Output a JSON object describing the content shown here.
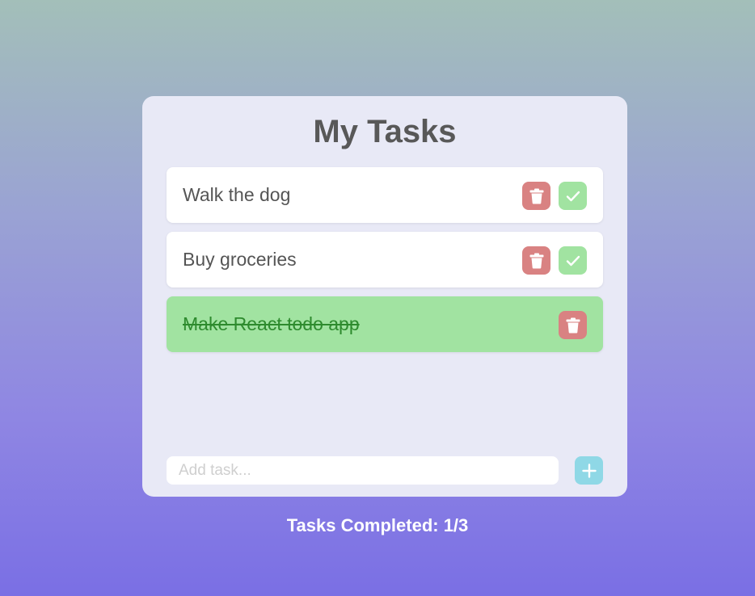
{
  "app": {
    "title": "My Tasks"
  },
  "tasks": [
    {
      "label": "Walk the dog",
      "completed": false
    },
    {
      "label": "Buy groceries",
      "completed": false
    },
    {
      "label": "Make React todo app",
      "completed": true
    }
  ],
  "add_task": {
    "placeholder": "Add task...",
    "value": "",
    "button_icon": "plus-icon"
  },
  "icons": {
    "delete": "trash-icon",
    "complete": "check-icon"
  },
  "colors": {
    "delete_button": "#d98282",
    "complete_button": "#a1e3a1",
    "completed_task_bg": "#a1e3a1",
    "add_button": "#8fd8e6"
  },
  "footer": {
    "status": "Tasks Completed: 1/3"
  }
}
